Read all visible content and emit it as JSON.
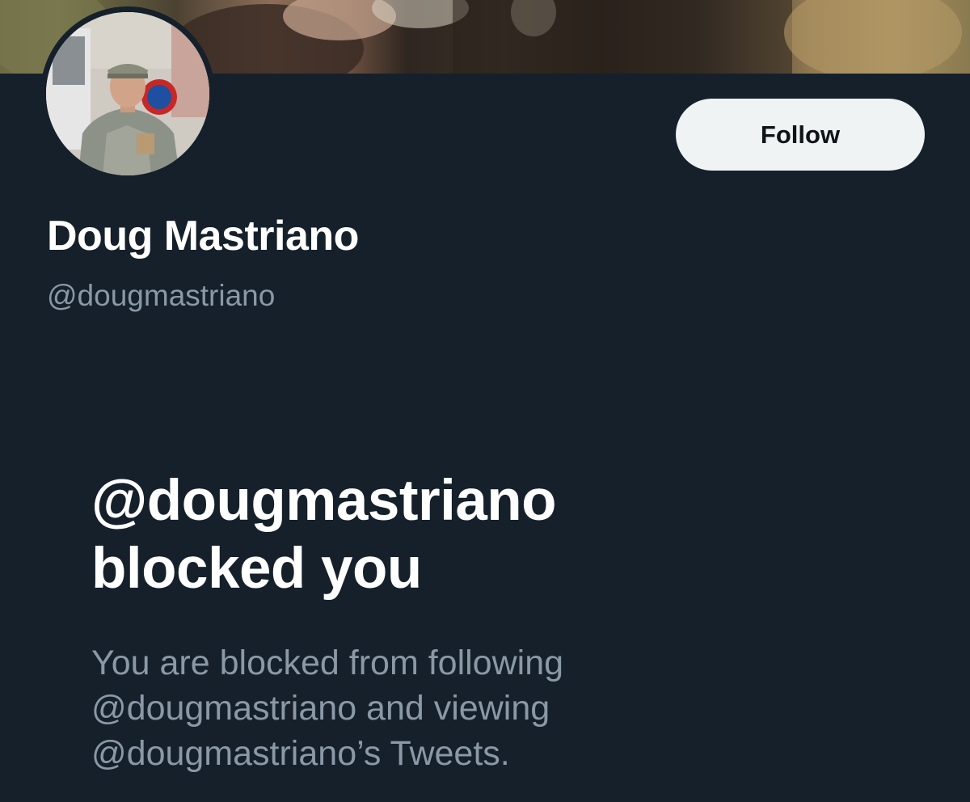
{
  "profile": {
    "display_name": "Doug Mastriano",
    "handle": "@dougmastriano",
    "follow_label": "Follow"
  },
  "blocked": {
    "title_line1": "@dougmastriano",
    "title_line2": "blocked you",
    "description_line1": "You are blocked from following",
    "description_line2": "@dougmastriano and viewing",
    "description_line3": "@dougmastriano’s Tweets."
  },
  "colors": {
    "background": "#15202b",
    "primary_text": "#ffffff",
    "secondary_text": "#8b98a5",
    "button_bg": "#eff3f4"
  }
}
